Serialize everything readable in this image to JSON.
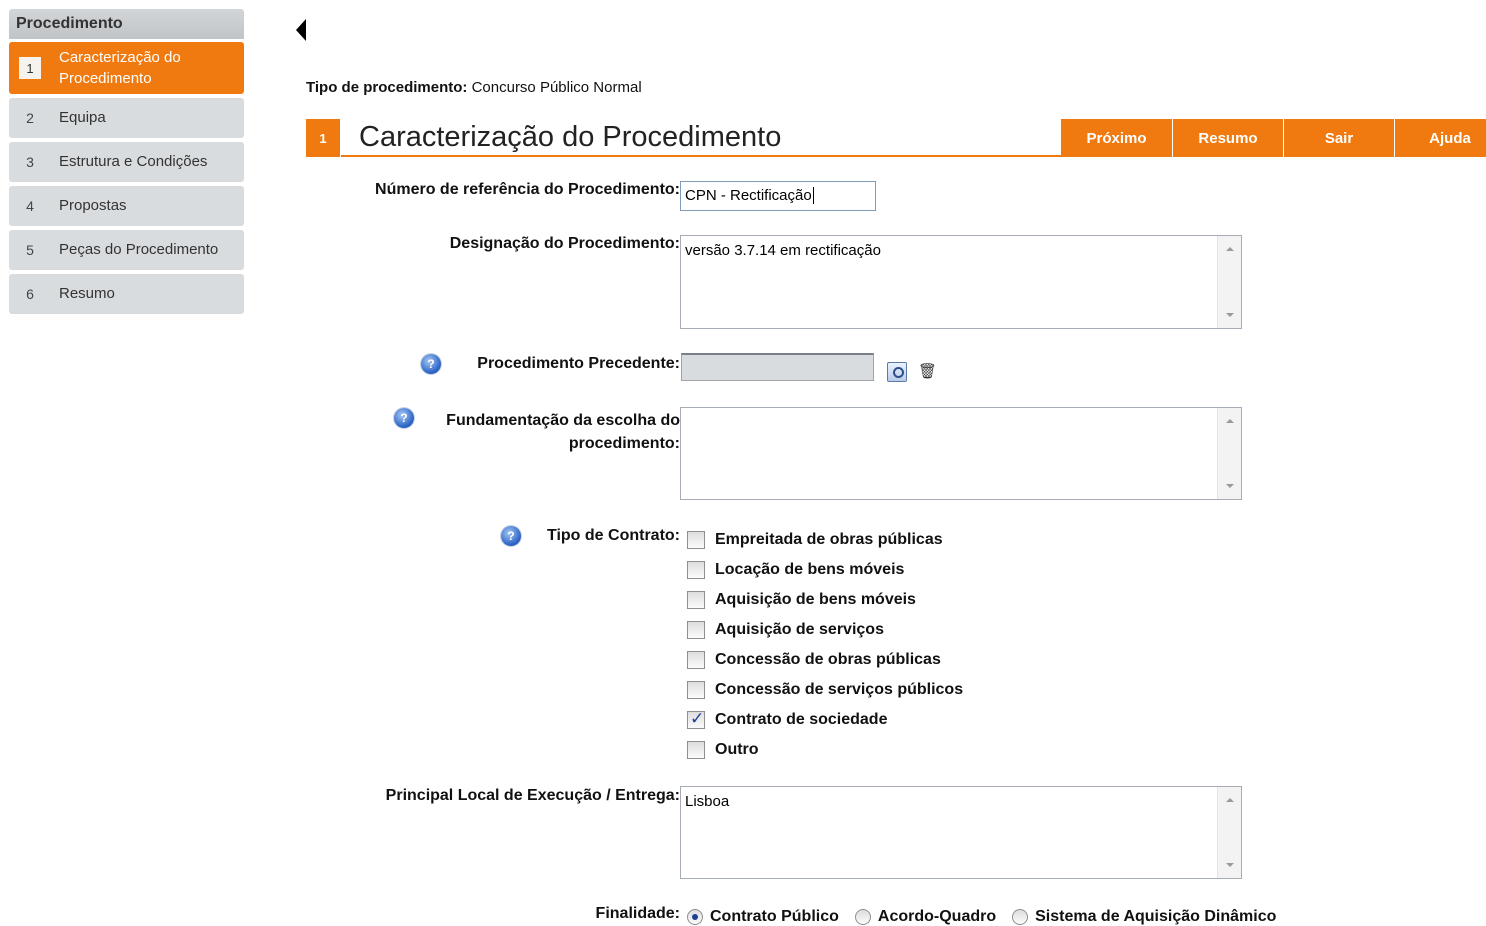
{
  "sidebar": {
    "title": "Procedimento",
    "steps": [
      {
        "num": "1",
        "label": "Caracterização do Procedimento"
      },
      {
        "num": "2",
        "label": "Equipa"
      },
      {
        "num": "3",
        "label": "Estrutura e Condições"
      },
      {
        "num": "4",
        "label": "Propostas"
      },
      {
        "num": "5",
        "label": "Peças do Procedimento"
      },
      {
        "num": "6",
        "label": "Resumo"
      }
    ]
  },
  "header": {
    "proc_type_label": "Tipo de procedimento:",
    "proc_type_value": "Concurso Público Normal",
    "step_num": "1",
    "title": "Caracterização do Procedimento",
    "tabs": [
      "Próximo",
      "Resumo",
      "Sair",
      "Ajuda"
    ]
  },
  "form": {
    "ref_label": "Número de referência do Procedimento:",
    "ref_value": "CPN - Rectificação",
    "designation_label": "Designação do Procedimento:",
    "designation_value": "versão 3.7.14 em rectificação",
    "precedent_label": "Procedimento Precedente:",
    "justification_label_1": "Fundamentação da escolha do",
    "justification_label_2": "procedimento:",
    "contract_type_label": "Tipo de Contrato:",
    "contract_types": [
      {
        "label": "Empreitada de obras públicas",
        "checked": false
      },
      {
        "label": "Locação de bens móveis",
        "checked": false
      },
      {
        "label": "Aquisição de bens móveis",
        "checked": false
      },
      {
        "label": "Aquisição de serviços",
        "checked": false
      },
      {
        "label": "Concessão de obras públicas",
        "checked": false
      },
      {
        "label": "Concessão de serviços públicos",
        "checked": false
      },
      {
        "label": "Contrato de sociedade",
        "checked": true
      },
      {
        "label": "Outro",
        "checked": false
      }
    ],
    "location_label": "Principal Local de Execução / Entrega:",
    "location_value": "Lisboa",
    "purpose_label": "Finalidade:",
    "purpose_options": [
      {
        "label": "Contrato Público",
        "selected": true
      },
      {
        "label": "Acordo-Quadro",
        "selected": false
      },
      {
        "label": "Sistema de Aquisição Dinâmico",
        "selected": false
      }
    ]
  },
  "colors": {
    "accent": "#f07a10"
  }
}
